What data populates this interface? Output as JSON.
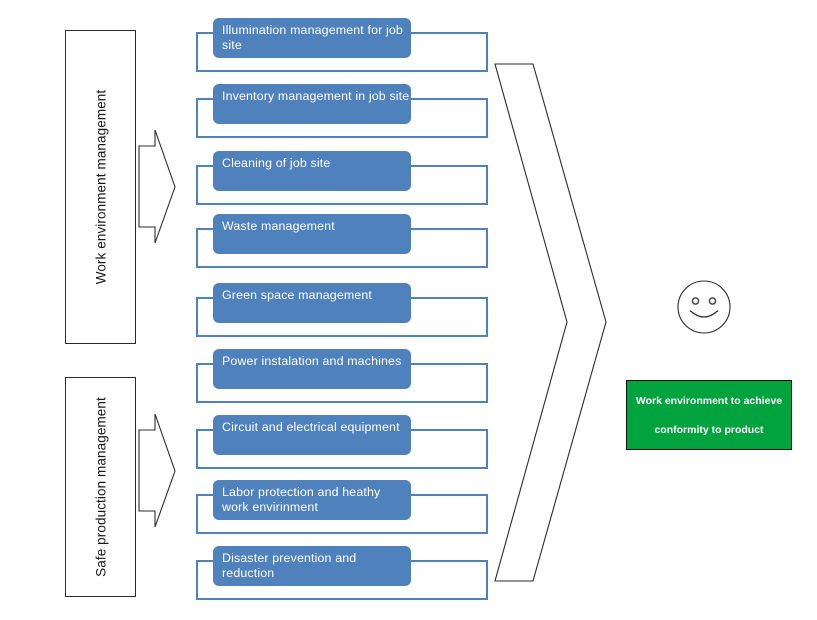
{
  "diagram": {
    "title": "Work environment management process diagram",
    "colors": {
      "chip_blue": "#4F81BD",
      "outline_blue": "#4F81BD",
      "result_green": "#00A33E",
      "stroke_black": "#2b2b2b",
      "text_white": "#FFFFFF"
    },
    "categories": [
      {
        "id": "work-environment-management",
        "label": "Work environment management"
      },
      {
        "id": "safe-production-management",
        "label": "Safe production management"
      }
    ],
    "processes": [
      {
        "id": "illumination-management",
        "label": "Illumination management  for job site",
        "lines": [
          "Illumination management  for job",
          "site"
        ]
      },
      {
        "id": "inventory-management",
        "label": "Inventory management in job site",
        "lines": [
          "Inventory management in job site"
        ]
      },
      {
        "id": "cleaning-of-job-site",
        "label": "Cleaning of job site",
        "lines": [
          "Cleaning of job site"
        ]
      },
      {
        "id": "waste-management",
        "label": "Waste management",
        "lines": [
          "Waste management"
        ]
      },
      {
        "id": "green-space-management",
        "label": "Green space management",
        "lines": [
          "Green space management"
        ]
      },
      {
        "id": "power-instalation-and-machines",
        "label": "Power instalation and machines",
        "lines": [
          "Power instalation and machines"
        ]
      },
      {
        "id": "circuit-and-electrical-equipment",
        "label": "Circuit and   electrical equipment",
        "lines": [
          "Circuit and   electrical equipment"
        ]
      },
      {
        "id": "labor-protection",
        "label": "Labor protection and  heathy work envirinment",
        "lines": [
          "Labor protection and  heathy",
          "work envirinment"
        ]
      },
      {
        "id": "disaster-prevention-and-reduction",
        "label": "Disaster prevention and reduction",
        "lines": [
          "Disaster prevention and reduction"
        ]
      }
    ],
    "outcome": {
      "id": "work-environment-outcome",
      "line1": "Work environment to achieve",
      "line2": "conformity to product",
      "full_text": "Work environment to achieve conformity to product"
    },
    "icons": {
      "smiley": "smiley-face-icon",
      "big_arrow": "large-right-arrow-icon",
      "category_arrow": "right-arrow-connector-icon"
    }
  }
}
